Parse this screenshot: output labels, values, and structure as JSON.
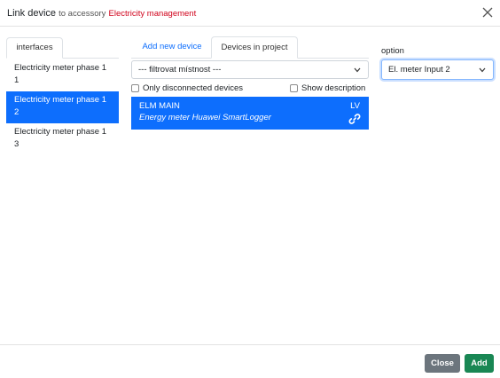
{
  "dialog": {
    "title_strong": "Link device",
    "title_muted": "to accessory",
    "title_accent": "Electricity management"
  },
  "left": {
    "tab_label": "interfaces",
    "interfaces": [
      {
        "line1": "Electricity meter phase 1",
        "line2": "1"
      },
      {
        "line1": "Electricity meter phase 1",
        "line2": "2"
      },
      {
        "line1": "Electricity meter phase 1",
        "line2": "3"
      }
    ],
    "selected_index": 1
  },
  "middle": {
    "tabs": [
      {
        "label": "Add new device"
      },
      {
        "label": "Devices in project"
      }
    ],
    "active_tab": 1,
    "room_filter": "--- filtrovat místnost ---",
    "only_disconnected_label": "Only disconnected devices",
    "show_description_label": "Show description",
    "device": {
      "name": "ELM MAIN",
      "description": "Energy meter Huawei SmartLogger",
      "tag": "LV",
      "icon": "link-icon"
    }
  },
  "right": {
    "option_label": "option",
    "option_value": "El. meter Input 2"
  },
  "footer": {
    "close_label": "Close",
    "add_label": "Add"
  },
  "colors": {
    "primary": "#0d6efd",
    "accent_red": "#d0021b",
    "secondary_button": "#6c757d",
    "success_button": "#198754"
  }
}
